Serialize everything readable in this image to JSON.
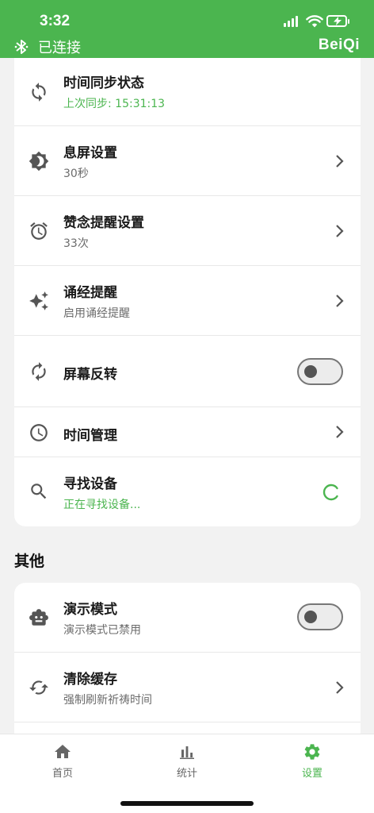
{
  "status": {
    "time": "3:32"
  },
  "header": {
    "connection_text": "已连接",
    "brand": "BeiQi"
  },
  "settings": {
    "time_sync": {
      "title": "时间同步状态",
      "subtitle": "上次同步: 15:31:13",
      "icon": "sync-icon"
    },
    "screen_off": {
      "title": "息屏设置",
      "subtitle": "30秒",
      "icon": "brightness-icon"
    },
    "praise_reminder": {
      "title": "赞念提醒设置",
      "subtitle": "33次",
      "icon": "alarm-icon"
    },
    "chant_reminder": {
      "title": "诵经提醒",
      "subtitle": "启用诵经提醒",
      "icon": "sparkle-icon"
    },
    "screen_flip": {
      "title": "屏幕反转",
      "toggle_on": false,
      "icon": "rotate-icon"
    },
    "time_manage": {
      "title": "时间管理",
      "icon": "clock-icon"
    },
    "find_device": {
      "title": "寻找设备",
      "subtitle": "正在寻找设备...",
      "icon": "search-icon"
    }
  },
  "other": {
    "section_title": "其他",
    "demo_mode": {
      "title": "演示模式",
      "subtitle": "演示模式已禁用",
      "toggle_on": false,
      "icon": "robot-icon"
    },
    "clear_cache": {
      "title": "清除缓存",
      "subtitle": "强制刷新祈祷时间",
      "icon": "refresh-icon"
    }
  },
  "tabs": [
    {
      "label": "首页",
      "icon": "home-icon",
      "active": false
    },
    {
      "label": "统计",
      "icon": "bar-chart-icon",
      "active": false
    },
    {
      "label": "设置",
      "icon": "gear-icon",
      "active": true
    }
  ],
  "colors": {
    "accent": "#4bb54f",
    "icon_gray": "#555555",
    "tab_gray": "#666666"
  }
}
